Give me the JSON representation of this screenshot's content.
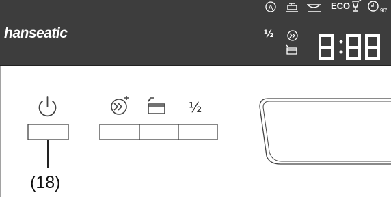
{
  "brand": "hanseatic",
  "display": {
    "time": "8:88",
    "eco_label": "ECO",
    "half_load_symbol": "½",
    "indicator_icons": [
      "auto-program-icon",
      "intensive-pot-icon",
      "normal-bowl-icon",
      "eco-label",
      "glass-icon",
      "delay-timer-90-icon",
      "half-load-symbol",
      "turbo-program-icon",
      "tray-icon"
    ]
  },
  "buttons": {
    "power_icon": "power-icon",
    "turbo_icon": "turbo-plus-icon",
    "tray_icon": "tray-arrow-icon",
    "half_load_label": "½"
  },
  "callout_label": "(18)",
  "colors": {
    "panel": "#3d3d3d",
    "display_digits": "#ffffff",
    "outline": "#444444",
    "background": "#ffffff"
  }
}
